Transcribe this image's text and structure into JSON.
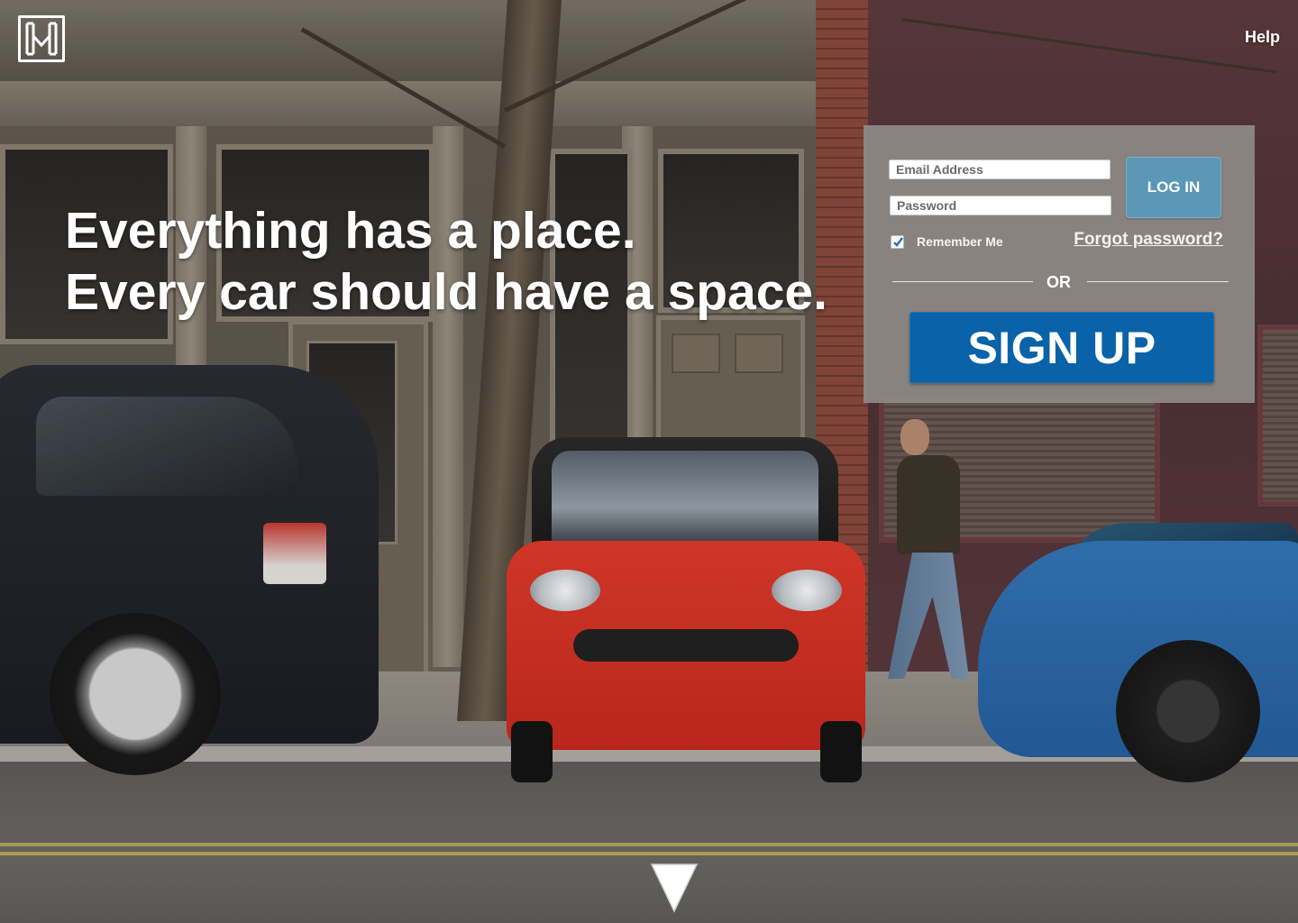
{
  "header": {
    "logo_alt": "logo",
    "help_label": "Help"
  },
  "hero": {
    "line1": "Everything has a place.",
    "line2": "Every car should have a space."
  },
  "login": {
    "email_placeholder": "Email Address",
    "password_placeholder": "Password",
    "login_label": "LOG IN",
    "remember_label": "Remember Me",
    "remember_checked": true,
    "forgot_label": "Forgot password?",
    "or_label": "OR",
    "signup_label": "SIGN UP"
  },
  "colors": {
    "signup_blue": "#0a62a8",
    "login_blue": "#5b97b6",
    "panel_gray": "#8e8a87"
  },
  "icons": {
    "logo": "hm-monogram-icon",
    "scroll": "down-triangle-icon",
    "check": "checkmark-icon"
  }
}
